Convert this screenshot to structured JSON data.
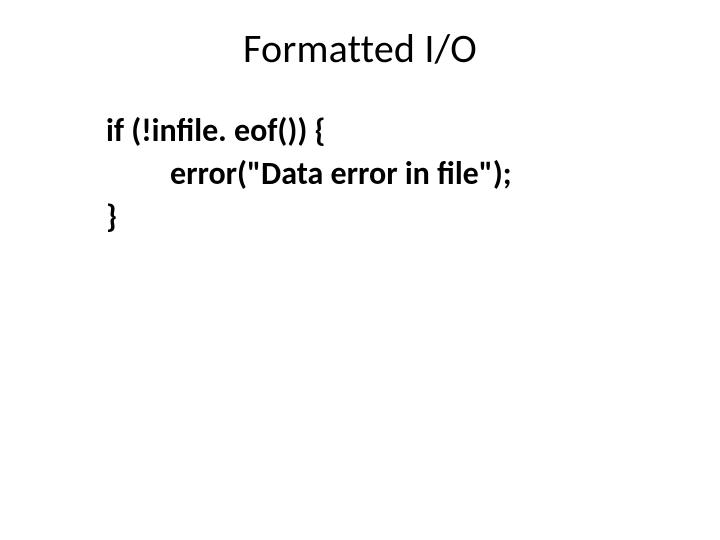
{
  "title": "Formatted I/O",
  "code": {
    "line1": "if (!infile. eof()) {",
    "line2": "error(\"Data error in file\");",
    "line3": "}"
  }
}
